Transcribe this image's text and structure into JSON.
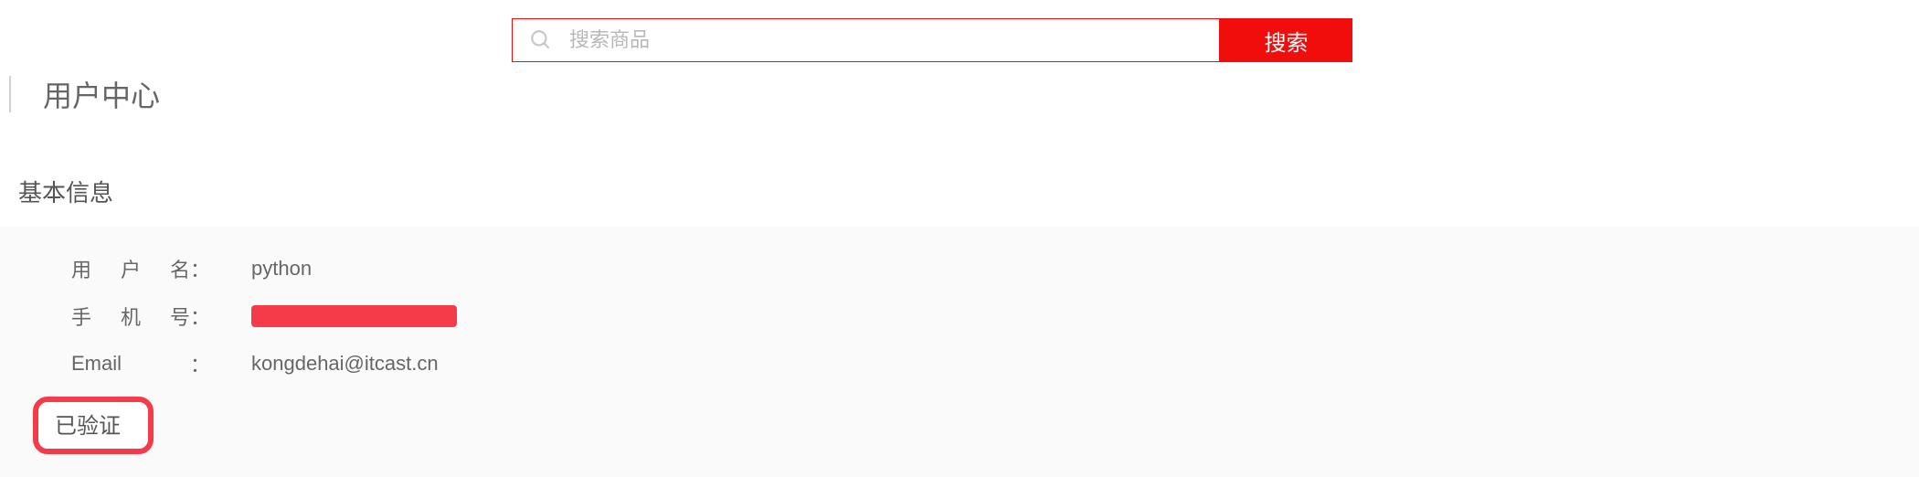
{
  "header": {
    "title": "用户中心"
  },
  "search": {
    "placeholder": "搜索商品",
    "button_label": "搜索"
  },
  "section": {
    "title": "基本信息"
  },
  "info": {
    "username_label": "用户名",
    "username_value": "python",
    "phone_label": "手机号",
    "email_label": "Email",
    "email_value": "kongdehai@itcast.cn",
    "verified_label": "已验证"
  }
}
